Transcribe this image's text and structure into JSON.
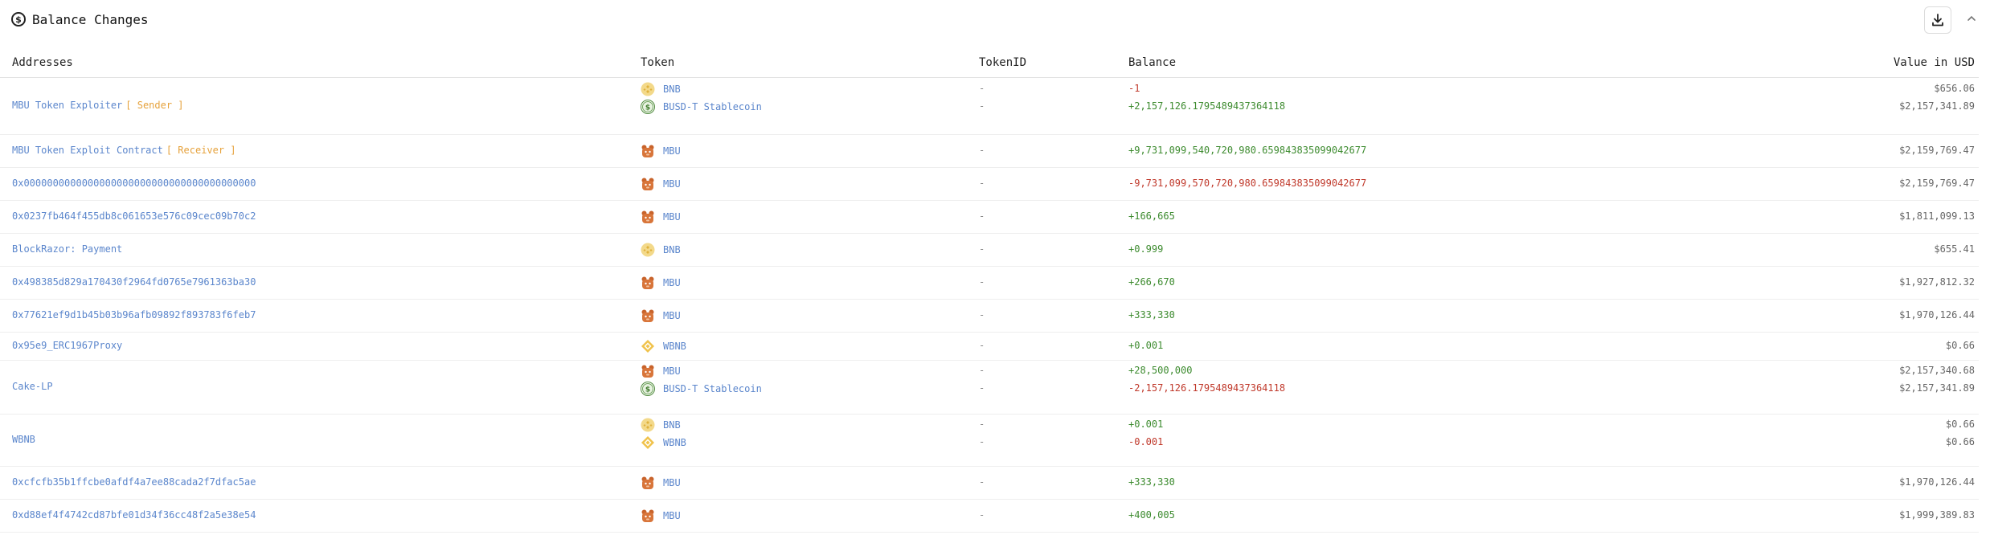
{
  "header": {
    "title": "Balance Changes"
  },
  "columns": {
    "addresses": "Addresses",
    "token": "Token",
    "token_id": "TokenID",
    "balance": "Balance",
    "usd": "Value in USD"
  },
  "colors": {
    "link": "#5b86cc",
    "role": "#e6a23c",
    "positive": "#3d8b2f",
    "negative": "#c0392b"
  },
  "rows": [
    {
      "address": "MBU Token Exploiter",
      "role": "[ Sender ]",
      "tokens": [
        {
          "icon": "bnb-icon",
          "name": "BNB",
          "token_id": "-",
          "balance": "-1",
          "sign": "neg",
          "usd": "$656.06"
        },
        {
          "icon": "busd-icon",
          "name": "BUSD-T Stablecoin",
          "token_id": "-",
          "balance": "+2,157,126.1795489437364118",
          "sign": "pos",
          "usd": "$2,157,341.89"
        }
      ]
    },
    {
      "address": "MBU Token Exploit Contract",
      "role": "[ Receiver ]",
      "tokens": [
        {
          "icon": "mbu-icon",
          "name": "MBU",
          "token_id": "-",
          "balance": "+9,731,099,540,720,980.659843835099042677",
          "sign": "pos",
          "usd": "$2,159,769.47"
        }
      ]
    },
    {
      "address": "0x0000000000000000000000000000000000000000",
      "role": "",
      "tokens": [
        {
          "icon": "mbu-icon",
          "name": "MBU",
          "token_id": "-",
          "balance": "-9,731,099,570,720,980.659843835099042677",
          "sign": "neg",
          "usd": "$2,159,769.47"
        }
      ]
    },
    {
      "address": "0x0237fb464f455db8c061653e576c09cec09b70c2",
      "role": "",
      "tokens": [
        {
          "icon": "mbu-icon",
          "name": "MBU",
          "token_id": "-",
          "balance": "+166,665",
          "sign": "pos",
          "usd": "$1,811,099.13"
        }
      ]
    },
    {
      "address": "BlockRazor: Payment",
      "role": "",
      "tokens": [
        {
          "icon": "bnb-icon",
          "name": "BNB",
          "token_id": "-",
          "balance": "+0.999",
          "sign": "pos",
          "usd": "$655.41"
        }
      ]
    },
    {
      "address": "0x498385d829a170430f2964fd0765e7961363ba30",
      "role": "",
      "tokens": [
        {
          "icon": "mbu-icon",
          "name": "MBU",
          "token_id": "-",
          "balance": "+266,670",
          "sign": "pos",
          "usd": "$1,927,812.32"
        }
      ]
    },
    {
      "address": "0x77621ef9d1b45b03b96afb09892f893783f6feb7",
      "role": "",
      "tokens": [
        {
          "icon": "mbu-icon",
          "name": "MBU",
          "token_id": "-",
          "balance": "+333,330",
          "sign": "pos",
          "usd": "$1,970,126.44"
        }
      ]
    },
    {
      "address": "0x95e9_ERC1967Proxy",
      "role": "",
      "tokens": [
        {
          "icon": "wbnb-icon",
          "name": "WBNB",
          "token_id": "-",
          "balance": "+0.001",
          "sign": "pos",
          "usd": "$0.66"
        }
      ]
    },
    {
      "address": "Cake-LP",
      "role": "",
      "tokens": [
        {
          "icon": "mbu-icon",
          "name": "MBU",
          "token_id": "-",
          "balance": "+28,500,000",
          "sign": "pos",
          "usd": "$2,157,340.68"
        },
        {
          "icon": "busd-icon",
          "name": "BUSD-T Stablecoin",
          "token_id": "-",
          "balance": "-2,157,126.1795489437364118",
          "sign": "neg",
          "usd": "$2,157,341.89"
        }
      ]
    },
    {
      "address": "WBNB",
      "role": "",
      "tokens": [
        {
          "icon": "bnb-icon",
          "name": "BNB",
          "token_id": "-",
          "balance": "+0.001",
          "sign": "pos",
          "usd": "$0.66"
        },
        {
          "icon": "wbnb-icon",
          "name": "WBNB",
          "token_id": "-",
          "balance": "-0.001",
          "sign": "neg",
          "usd": "$0.66"
        }
      ]
    },
    {
      "address": "0xcfcfb35b1ffcbe0afdf4a7ee88cada2f7dfac5ae",
      "role": "",
      "tokens": [
        {
          "icon": "mbu-icon",
          "name": "MBU",
          "token_id": "-",
          "balance": "+333,330",
          "sign": "pos",
          "usd": "$1,970,126.44"
        }
      ]
    },
    {
      "address": "0xd88ef4f4742cd87bfe01d34f36cc48f2a5e38e54",
      "role": "",
      "tokens": [
        {
          "icon": "mbu-icon",
          "name": "MBU",
          "token_id": "-",
          "balance": "+400,005",
          "sign": "pos",
          "usd": "$1,999,389.83"
        }
      ]
    }
  ]
}
